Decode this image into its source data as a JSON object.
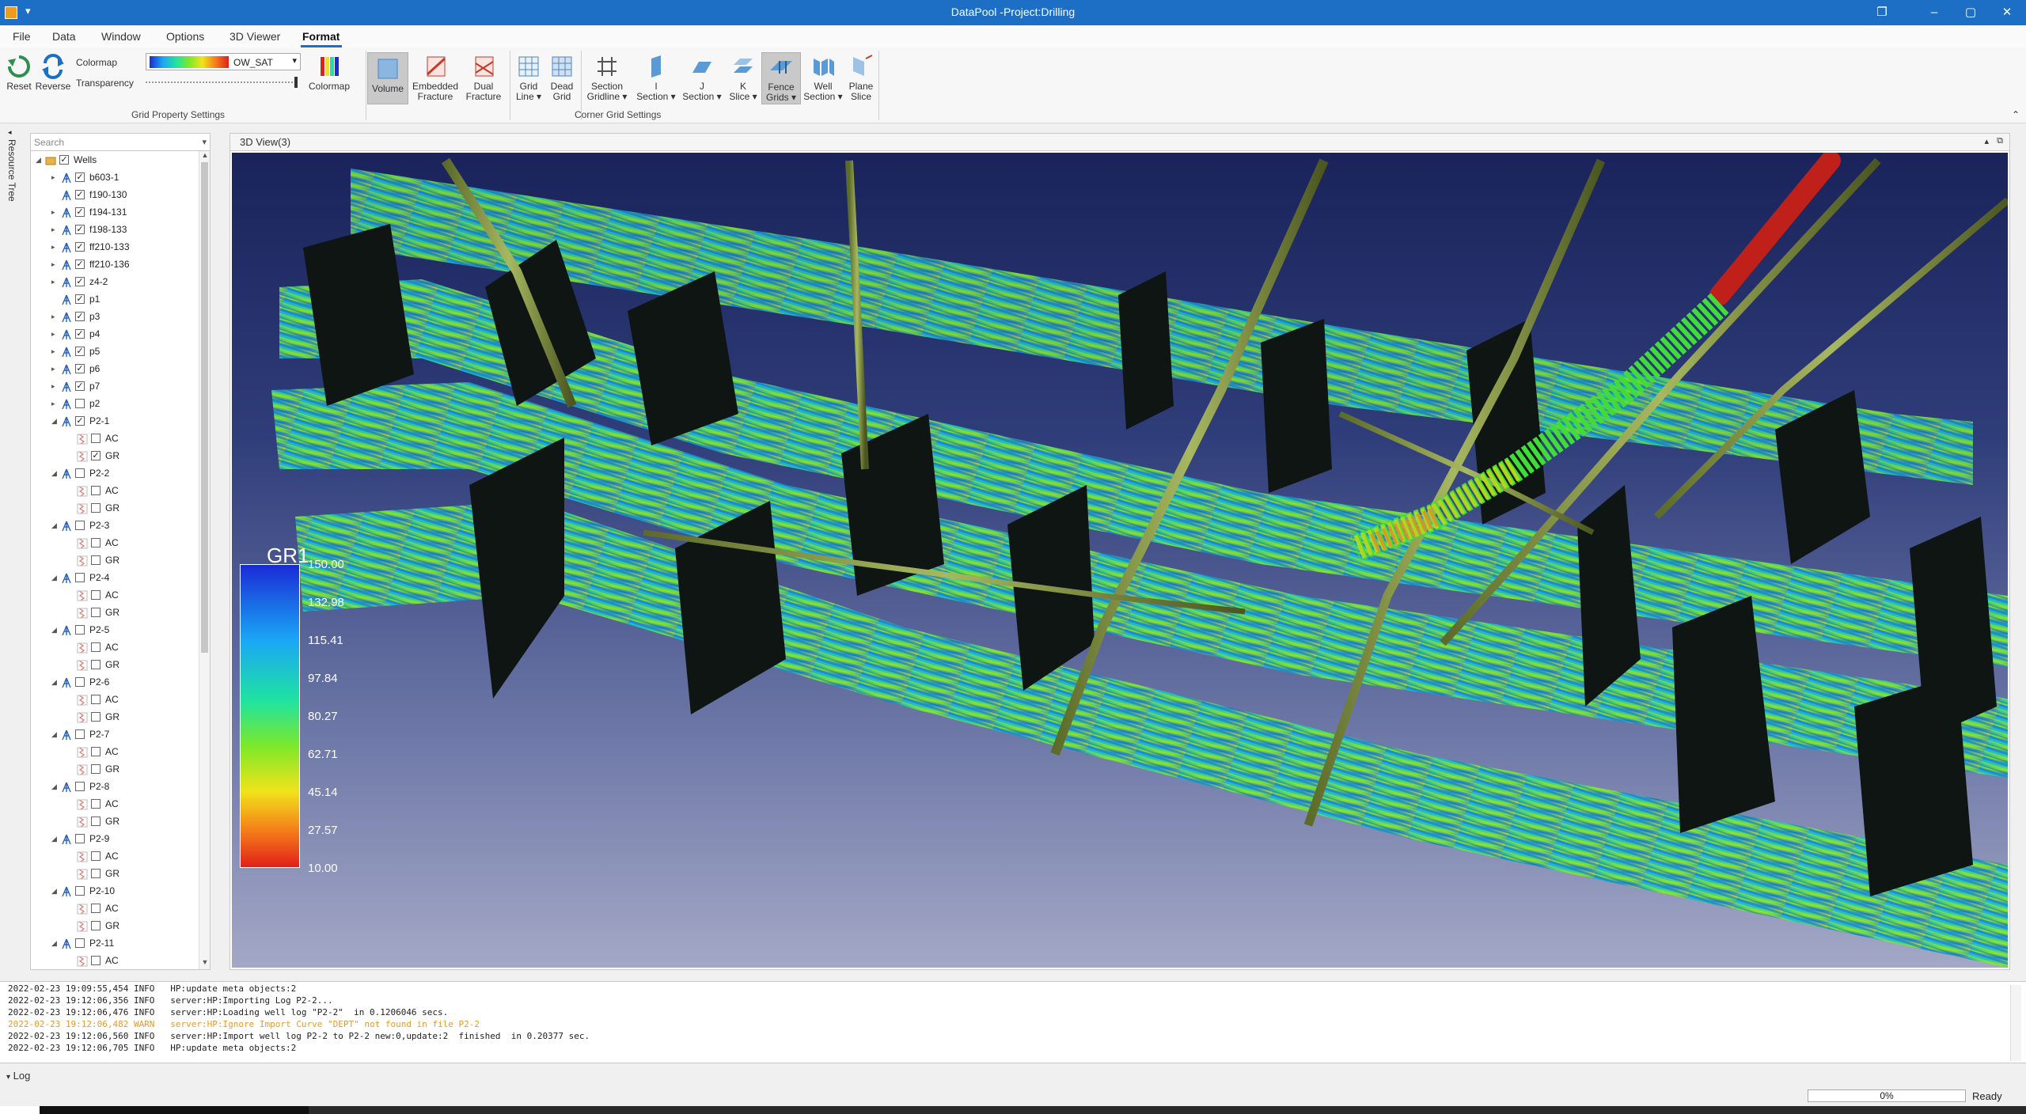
{
  "window": {
    "title": "DataPool -Project:Drilling",
    "controls": [
      "restore-icon",
      "minimize-icon",
      "maximize-icon",
      "close-icon"
    ]
  },
  "menu": [
    "File",
    "Data",
    "Window",
    "Options",
    "3D Viewer",
    "Format"
  ],
  "menu_active": "Format",
  "ribbon": {
    "grid_property": {
      "reset": "Reset",
      "reverse": "Reverse",
      "colormap_label": "Colormap",
      "transparency_label": "Transparency",
      "colormap_value": "OW_SAT",
      "colormap_button": "Colormap",
      "group_label": "Grid Property Settings"
    },
    "corner_grid": {
      "buttons": [
        {
          "l1": "Volume",
          "l2": "",
          "selected": true
        },
        {
          "l1": "Embedded",
          "l2": "Fracture",
          "selected": false
        },
        {
          "l1": "Dual",
          "l2": "Fracture",
          "selected": false
        },
        {
          "l1": "Grid",
          "l2": "Line ▾",
          "selected": false
        },
        {
          "l1": "Dead",
          "l2": "Grid",
          "selected": false
        },
        {
          "l1": "Section",
          "l2": "Gridline ▾",
          "selected": false
        },
        {
          "l1": "I",
          "l2": "Section ▾",
          "selected": false
        },
        {
          "l1": "J",
          "l2": "Section ▾",
          "selected": false
        },
        {
          "l1": "K",
          "l2": "Slice ▾",
          "selected": false
        },
        {
          "l1": "Fence",
          "l2": "Grids ▾",
          "selected": true
        },
        {
          "l1": "Well",
          "l2": "Section ▾",
          "selected": false
        },
        {
          "l1": "Plane",
          "l2": "Slice",
          "selected": false
        }
      ],
      "group_label": "Corner Grid Settings"
    }
  },
  "resource_tree": {
    "side_label": "Resource Tree",
    "search_placeholder": "Search",
    "rows": [
      {
        "label": "Wells",
        "level": 0,
        "expander": "◢",
        "checked": true,
        "icon": "folder"
      },
      {
        "label": "b603-1",
        "level": 1,
        "expander": "▸",
        "checked": true,
        "icon": "well"
      },
      {
        "label": "f190-130",
        "level": 1,
        "expander": "",
        "checked": true,
        "icon": "well"
      },
      {
        "label": "f194-131",
        "level": 1,
        "expander": "▸",
        "checked": true,
        "icon": "well"
      },
      {
        "label": "f198-133",
        "level": 1,
        "expander": "▸",
        "checked": true,
        "icon": "well"
      },
      {
        "label": "ff210-133",
        "level": 1,
        "expander": "▸",
        "checked": true,
        "icon": "well"
      },
      {
        "label": "ff210-136",
        "level": 1,
        "expander": "▸",
        "checked": true,
        "icon": "well"
      },
      {
        "label": "z4-2",
        "level": 1,
        "expander": "▸",
        "checked": true,
        "icon": "well"
      },
      {
        "label": "p1",
        "level": 1,
        "expander": "",
        "checked": true,
        "icon": "well"
      },
      {
        "label": "p3",
        "level": 1,
        "expander": "▸",
        "checked": true,
        "icon": "well"
      },
      {
        "label": "p4",
        "level": 1,
        "expander": "▸",
        "checked": true,
        "icon": "well"
      },
      {
        "label": "p5",
        "level": 1,
        "expander": "▸",
        "checked": true,
        "icon": "well"
      },
      {
        "label": "p6",
        "level": 1,
        "expander": "▸",
        "checked": true,
        "icon": "well"
      },
      {
        "label": "p7",
        "level": 1,
        "expander": "▸",
        "checked": true,
        "icon": "well"
      },
      {
        "label": "p2",
        "level": 1,
        "expander": "▸",
        "checked": false,
        "icon": "well"
      },
      {
        "label": "P2-1",
        "level": 1,
        "expander": "◢",
        "checked": true,
        "icon": "well"
      },
      {
        "label": "AC",
        "level": 2,
        "expander": "",
        "checked": false,
        "icon": "log"
      },
      {
        "label": "GR",
        "level": 2,
        "expander": "",
        "checked": true,
        "icon": "log"
      },
      {
        "label": "P2-2",
        "level": 1,
        "expander": "◢",
        "checked": false,
        "icon": "well"
      },
      {
        "label": "AC",
        "level": 2,
        "expander": "",
        "checked": false,
        "icon": "log"
      },
      {
        "label": "GR",
        "level": 2,
        "expander": "",
        "checked": false,
        "icon": "log"
      },
      {
        "label": "P2-3",
        "level": 1,
        "expander": "◢",
        "checked": false,
        "icon": "well"
      },
      {
        "label": "AC",
        "level": 2,
        "expander": "",
        "checked": false,
        "icon": "log"
      },
      {
        "label": "GR",
        "level": 2,
        "expander": "",
        "checked": false,
        "icon": "log"
      },
      {
        "label": "P2-4",
        "level": 1,
        "expander": "◢",
        "checked": false,
        "icon": "well"
      },
      {
        "label": "AC",
        "level": 2,
        "expander": "",
        "checked": false,
        "icon": "log"
      },
      {
        "label": "GR",
        "level": 2,
        "expander": "",
        "checked": false,
        "icon": "log"
      },
      {
        "label": "P2-5",
        "level": 1,
        "expander": "◢",
        "checked": false,
        "icon": "well"
      },
      {
        "label": "AC",
        "level": 2,
        "expander": "",
        "checked": false,
        "icon": "log"
      },
      {
        "label": "GR",
        "level": 2,
        "expander": "",
        "checked": false,
        "icon": "log"
      },
      {
        "label": "P2-6",
        "level": 1,
        "expander": "◢",
        "checked": false,
        "icon": "well"
      },
      {
        "label": "AC",
        "level": 2,
        "expander": "",
        "checked": false,
        "icon": "log"
      },
      {
        "label": "GR",
        "level": 2,
        "expander": "",
        "checked": false,
        "icon": "log"
      },
      {
        "label": "P2-7",
        "level": 1,
        "expander": "◢",
        "checked": false,
        "icon": "well"
      },
      {
        "label": "AC",
        "level": 2,
        "expander": "",
        "checked": false,
        "icon": "log"
      },
      {
        "label": "GR",
        "level": 2,
        "expander": "",
        "checked": false,
        "icon": "log"
      },
      {
        "label": "P2-8",
        "level": 1,
        "expander": "◢",
        "checked": false,
        "icon": "well"
      },
      {
        "label": "AC",
        "level": 2,
        "expander": "",
        "checked": false,
        "icon": "log"
      },
      {
        "label": "GR",
        "level": 2,
        "expander": "",
        "checked": false,
        "icon": "log"
      },
      {
        "label": "P2-9",
        "level": 1,
        "expander": "◢",
        "checked": false,
        "icon": "well"
      },
      {
        "label": "AC",
        "level": 2,
        "expander": "",
        "checked": false,
        "icon": "log"
      },
      {
        "label": "GR",
        "level": 2,
        "expander": "",
        "checked": false,
        "icon": "log"
      },
      {
        "label": "P2-10",
        "level": 1,
        "expander": "◢",
        "checked": false,
        "icon": "well"
      },
      {
        "label": "AC",
        "level": 2,
        "expander": "",
        "checked": false,
        "icon": "log"
      },
      {
        "label": "GR",
        "level": 2,
        "expander": "",
        "checked": false,
        "icon": "log"
      },
      {
        "label": "P2-11",
        "level": 1,
        "expander": "◢",
        "checked": false,
        "icon": "well"
      },
      {
        "label": "AC",
        "level": 2,
        "expander": "",
        "checked": false,
        "icon": "log"
      }
    ]
  },
  "view": {
    "title": "3D View(3)",
    "legend": {
      "title": "GR1",
      "ticks": [
        "150.00",
        "132.98",
        "115.41",
        "97.84",
        "80.27",
        "62.71",
        "45.14",
        "27.57",
        "10.00"
      ],
      "colors": [
        "#1a2bd6",
        "#1aa7f5",
        "#20e3a0",
        "#7de82a",
        "#f1e31a",
        "#f57d1a",
        "#e0201a"
      ]
    }
  },
  "log": {
    "tab_label": "Log",
    "lines": [
      {
        "text": "2022-02-23 19:09:55,454 INFO   HP:update meta objects:2",
        "level": "info"
      },
      {
        "text": "2022-02-23 19:12:06,356 INFO   server:HP:Importing Log P2-2...",
        "level": "info"
      },
      {
        "text": "2022-02-23 19:12:06,476 INFO   server:HP:Loading well log \"P2-2\"  in 0.1206046 secs.",
        "level": "info"
      },
      {
        "text": "2022-02-23 19:12:06,482 WARN   server:HP:Ignore Import Curve \"DEPT\" not found in file P2-2",
        "level": "warn"
      },
      {
        "text": "2022-02-23 19:12:06,560 INFO   server:HP:Import well log P2-2 to P2-2 new:0,update:2  finished  in 0.20377 sec.",
        "level": "info"
      },
      {
        "text": "2022-02-23 19:12:06,705 INFO   HP:update meta objects:2",
        "level": "info"
      }
    ]
  },
  "status": {
    "progress_percent": 0,
    "progress_text": "0%",
    "text": "Ready"
  }
}
